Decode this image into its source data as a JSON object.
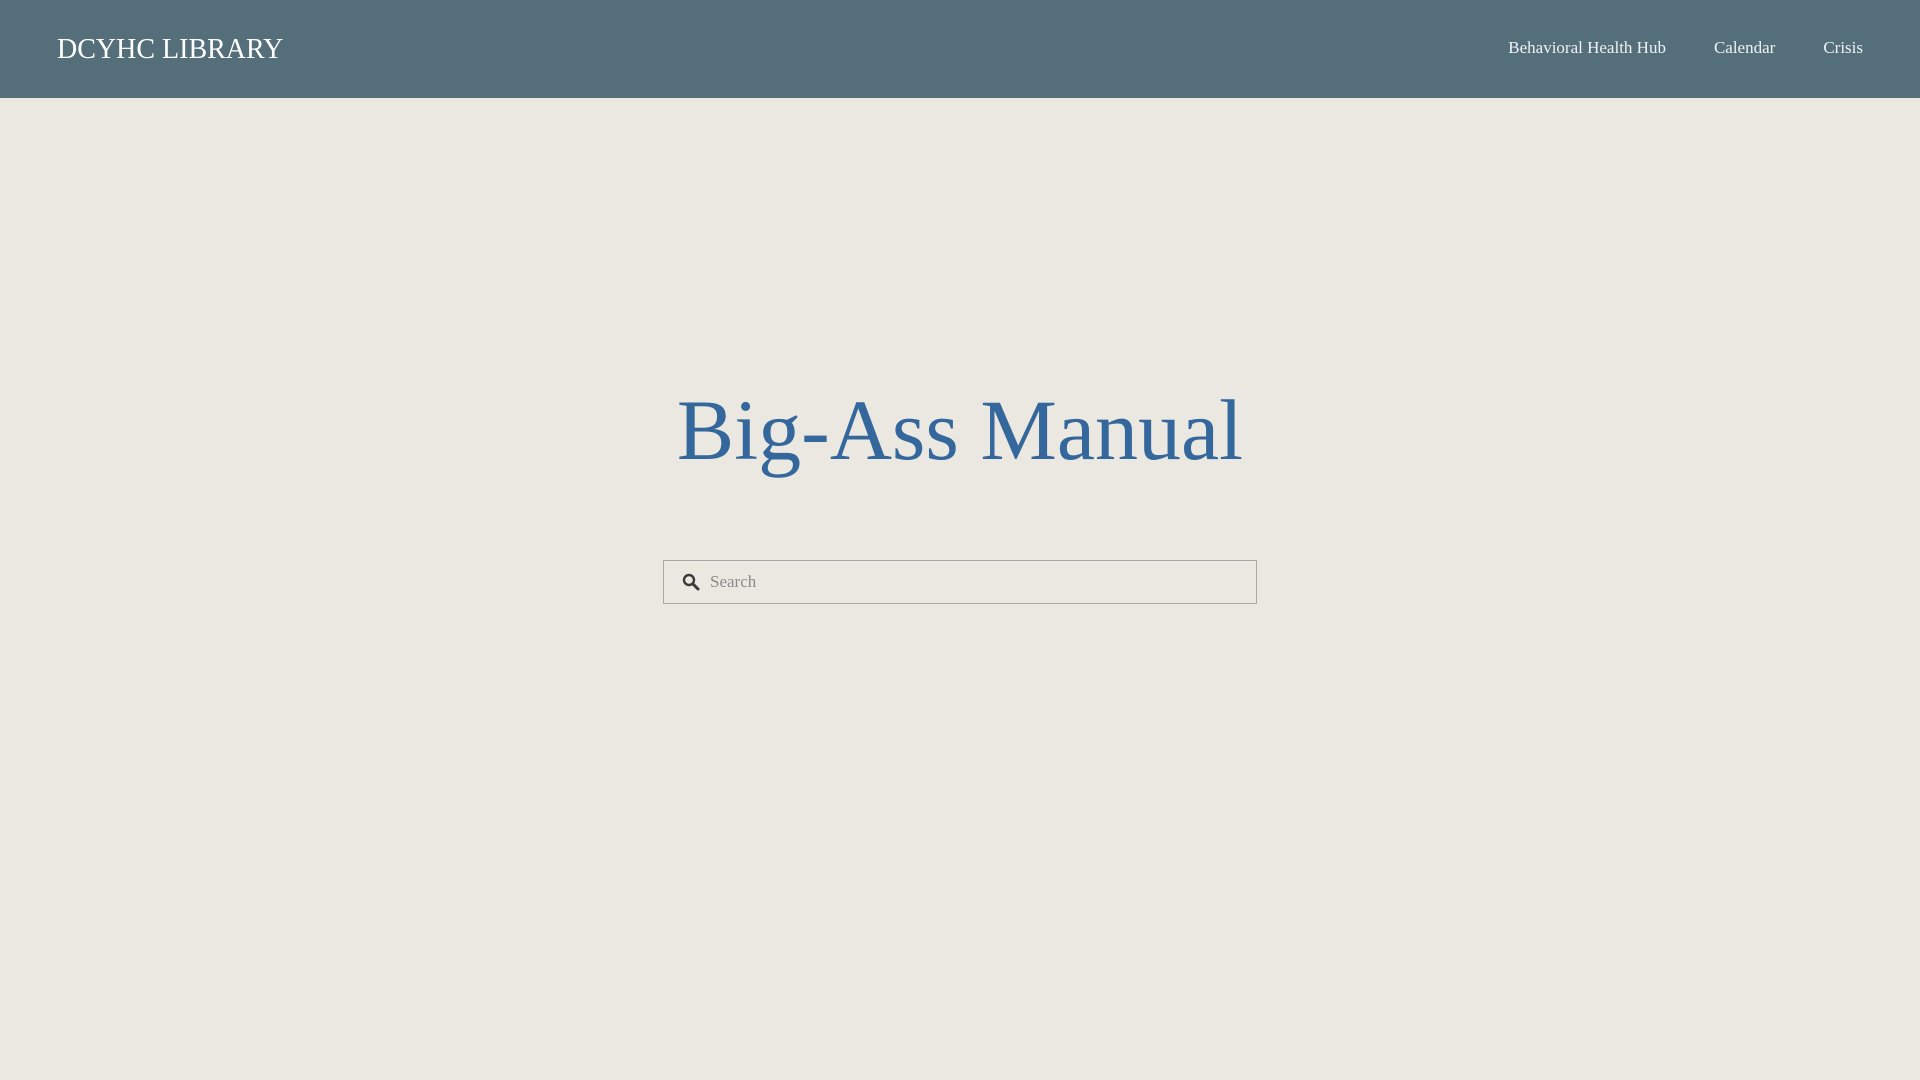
{
  "header": {
    "brand": "DCYHC LIBRARY",
    "nav": [
      {
        "label": "Behavioral Health Hub"
      },
      {
        "label": "Calendar"
      },
      {
        "label": "Crisis"
      }
    ]
  },
  "main": {
    "title": "Big-Ass Manual",
    "search": {
      "placeholder": "Search",
      "value": "",
      "icon": "search-icon"
    }
  },
  "colors": {
    "header_bg": "#546e7a",
    "page_bg": "#ebe7e1",
    "title": "#34679c"
  }
}
